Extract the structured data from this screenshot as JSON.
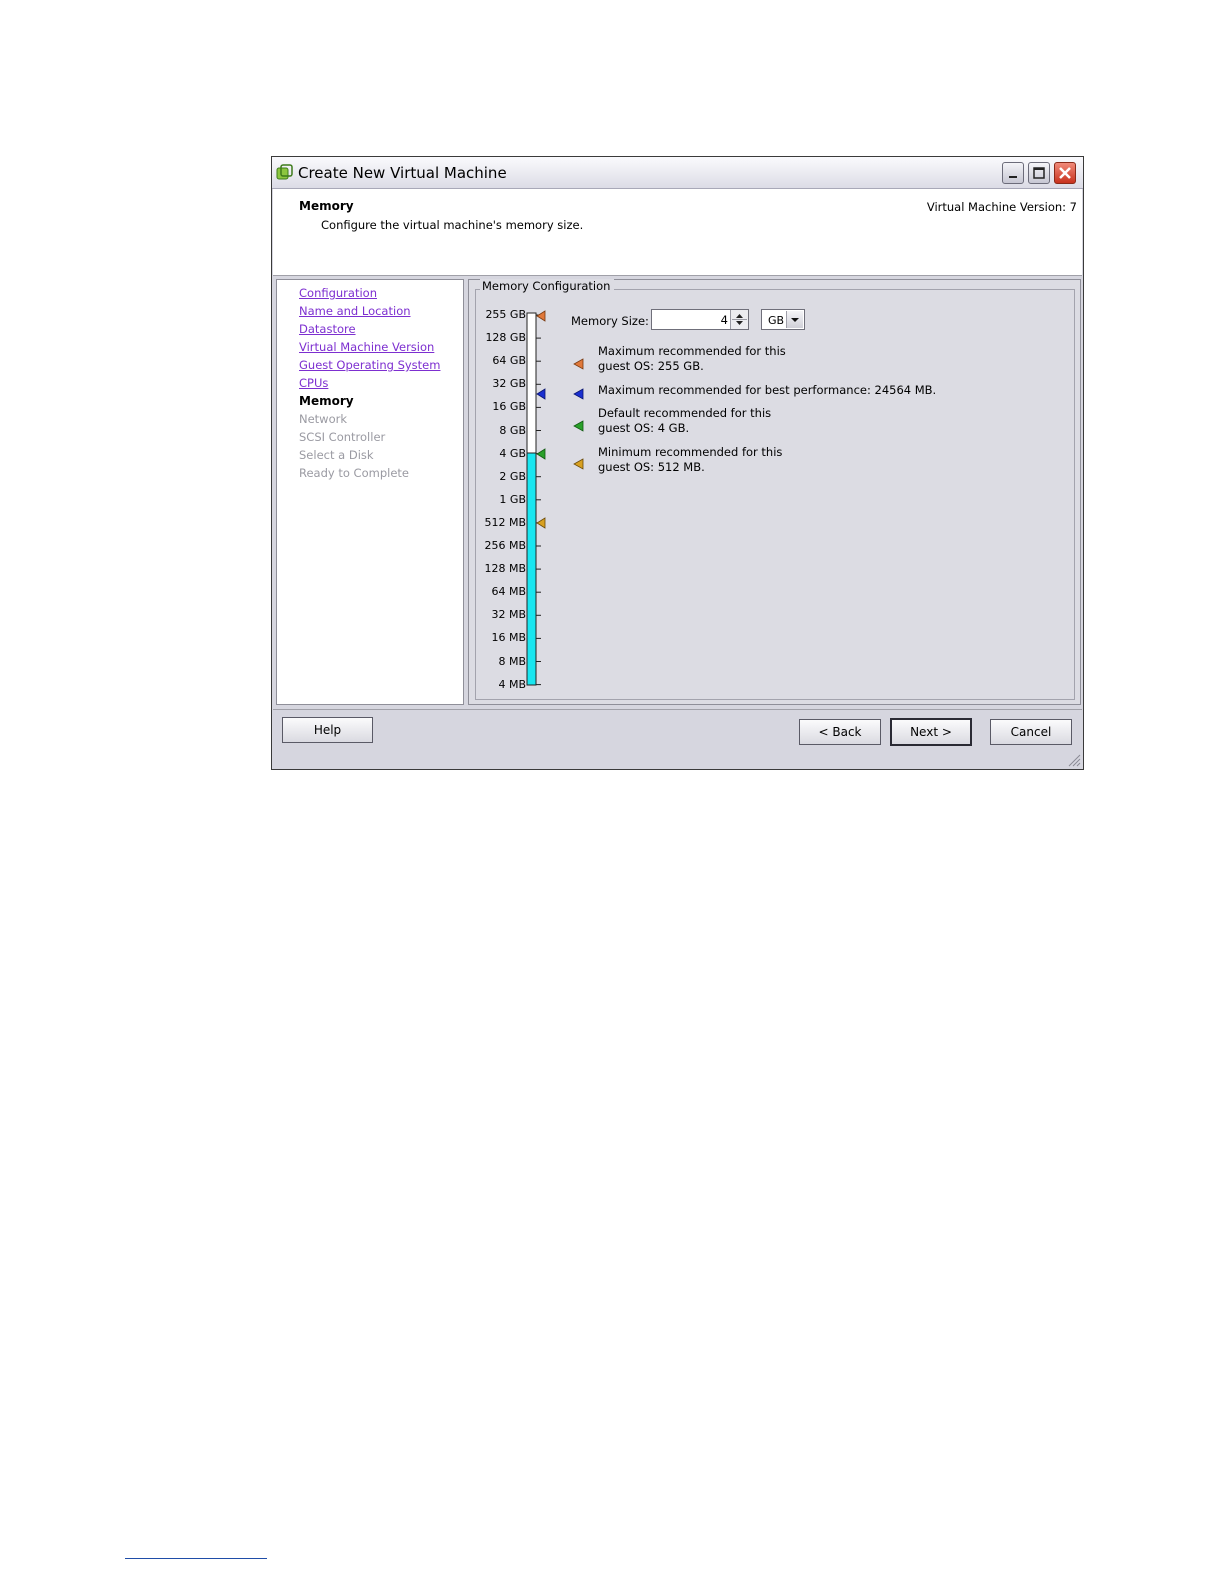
{
  "window": {
    "title": "Create New Virtual Machine"
  },
  "header": {
    "title": "Memory",
    "subtitle": "Configure the virtual machine's memory size.",
    "version": "Virtual Machine Version: 7"
  },
  "nav": {
    "items": [
      {
        "label": "Configuration",
        "state": "link"
      },
      {
        "label": "Name and Location",
        "state": "link"
      },
      {
        "label": "Datastore",
        "state": "link"
      },
      {
        "label": "Virtual Machine Version",
        "state": "link"
      },
      {
        "label": "Guest Operating System",
        "state": "link"
      },
      {
        "label": "CPUs",
        "state": "link"
      },
      {
        "label": "Memory",
        "state": "current"
      },
      {
        "label": "Network",
        "state": "disabled"
      },
      {
        "label": "SCSI Controller",
        "state": "disabled"
      },
      {
        "label": "Select a Disk",
        "state": "disabled"
      },
      {
        "label": "Ready to Complete",
        "state": "disabled"
      }
    ]
  },
  "memory_config": {
    "group_label": "Memory Configuration",
    "scale_labels": [
      "255 GB",
      "128 GB",
      "64 GB",
      "32 GB",
      "16 GB",
      "8 GB",
      "4 GB",
      "2 GB",
      "1 GB",
      "512 MB",
      "256 MB",
      "128 MB",
      "64 MB",
      "32 MB",
      "16 MB",
      "8 MB",
      "4 MB"
    ],
    "memory_size_label": "Memory Size:",
    "memory_size_value": "4",
    "unit": "GB",
    "legend": [
      {
        "line1": "Maximum recommended for this",
        "line2": "guest OS: 255 GB.",
        "color": "#e0783a"
      },
      {
        "line1": "Maximum recommended for best performance: 24564 MB.",
        "line2": "",
        "color": "#1a2fd0"
      },
      {
        "line1": "Default recommended for this",
        "line2": "guest OS: 4 GB.",
        "color": "#2aa02a"
      },
      {
        "line1": "Minimum recommended for this",
        "line2": "guest OS: 512 MB.",
        "color": "#d8a020"
      }
    ],
    "bar_color": "#19e6f0"
  },
  "buttons": {
    "help": "Help",
    "back": "< Back",
    "next": "Next >",
    "cancel": "Cancel"
  }
}
